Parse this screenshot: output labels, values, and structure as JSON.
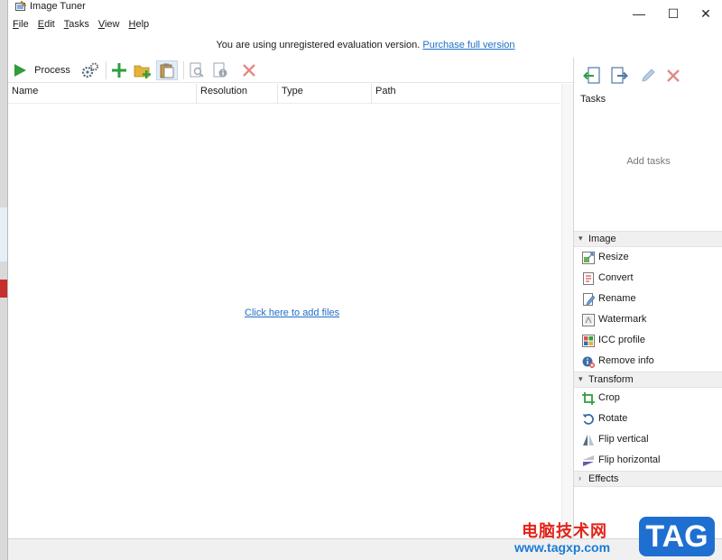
{
  "window": {
    "title": "Image Tuner",
    "minimize": "—",
    "maximize": "☐",
    "close": "✕"
  },
  "menu": [
    "File",
    "Edit",
    "Tasks",
    "View",
    "Help"
  ],
  "nag": {
    "text": "You are using unregistered evaluation version.",
    "link": "Purchase full version"
  },
  "toolbar": {
    "process_label": "Process"
  },
  "columns": [
    "Name",
    "Resolution",
    "Type",
    "Path"
  ],
  "file_area": {
    "add_files_link": "Click here to add files"
  },
  "tasks_panel": {
    "title": "Tasks",
    "empty_text": "Add tasks"
  },
  "sections": [
    {
      "label": "Image",
      "expanded": true,
      "items": [
        "Resize",
        "Convert",
        "Rename",
        "Watermark",
        "ICC profile",
        "Remove info"
      ]
    },
    {
      "label": "Transform",
      "expanded": true,
      "items": [
        "Crop",
        "Rotate",
        "Flip vertical",
        "Flip horizontal"
      ]
    },
    {
      "label": "Effects",
      "expanded": false,
      "items": []
    }
  ],
  "overlay_watermark": {
    "cn_text": "电脑技术网",
    "url": "www.tagxp.com",
    "badge": "TAG"
  },
  "colors": {
    "accent_link": "#1e6fc8",
    "process_green": "#2e9e3e",
    "delete_red": "#d9534f"
  }
}
